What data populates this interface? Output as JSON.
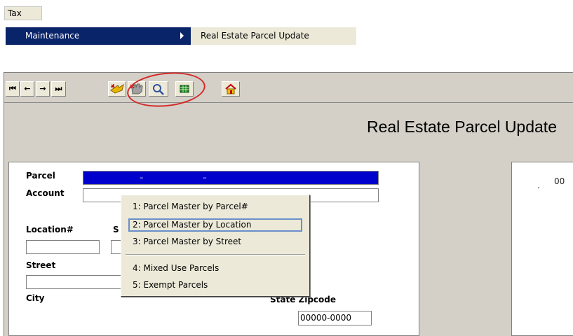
{
  "menu": {
    "tax": "Tax",
    "maintenance": "Maintenance",
    "submenu_item": "Real Estate Parcel Update"
  },
  "toolbar": {
    "first": "⏮",
    "prev": "←",
    "next": "→",
    "last": "⏭",
    "highlight": "search-button"
  },
  "window": {
    "title": "Real Estate Parcel Update"
  },
  "form": {
    "parcel_label": "Parcel",
    "parcel_value_a": "–",
    "parcel_value_b": "–",
    "account_label": "Account",
    "location_label": "Location#",
    "s_label": "S",
    "street_label": "Street",
    "city_label": "City",
    "state_zip_label": "State Zipcode",
    "zipcode_value": "00000-0000"
  },
  "right_panel": {
    "dot": ".",
    "value": "00"
  },
  "popup_menu": {
    "items": [
      "1: Parcel Master by Parcel#",
      "2: Parcel Master by Location",
      "3: Parcel Master by Street",
      "4: Mixed Use Parcels",
      "5: Exempt Parcels"
    ],
    "highlighted_index": 1
  }
}
